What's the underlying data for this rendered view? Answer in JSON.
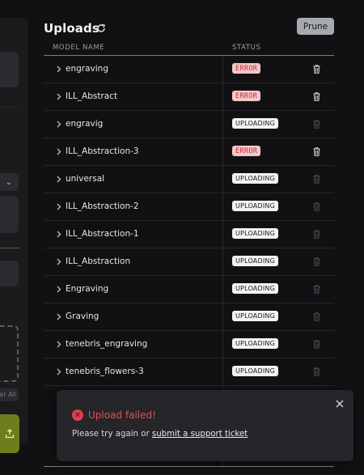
{
  "header": {
    "title": "Uploads",
    "prune_label": "Prune"
  },
  "table": {
    "columns": {
      "name": "MODEL NAME",
      "status": "STATUS"
    },
    "rows": [
      {
        "name": "engraving",
        "status": "ERROR",
        "state": "error"
      },
      {
        "name": "ILL_Abstract",
        "status": "ERROR",
        "state": "error"
      },
      {
        "name": "engravig",
        "status": "UPLOADING",
        "state": "uploading"
      },
      {
        "name": "ILL_Abstraction-3",
        "status": "ERROR",
        "state": "error"
      },
      {
        "name": "universal",
        "status": "UPLOADING",
        "state": "uploading"
      },
      {
        "name": "ILL_Abstraction-2",
        "status": "UPLOADING",
        "state": "uploading"
      },
      {
        "name": "ILL_Abstraction-1",
        "status": "UPLOADING",
        "state": "uploading"
      },
      {
        "name": "ILL_Abstraction",
        "status": "UPLOADING",
        "state": "uploading"
      },
      {
        "name": "Engraving",
        "status": "UPLOADING",
        "state": "uploading"
      },
      {
        "name": "Graving",
        "status": "UPLOADING",
        "state": "uploading"
      },
      {
        "name": "tenebris_engraving",
        "status": "UPLOADING",
        "state": "uploading"
      },
      {
        "name": "tenebris_flowers-3",
        "status": "UPLOADING",
        "state": "uploading"
      }
    ]
  },
  "left_panel": {
    "clear_all_label": "ar All"
  },
  "toast": {
    "title": "Upload failed!",
    "message_prefix": "Please try again or ",
    "link_text": "submit a support ticket"
  },
  "colors": {
    "error": "#e1404a",
    "accent": "#6f7d1c"
  },
  "icons": [
    "refresh-icon",
    "chevron-right-icon",
    "trash-icon",
    "error-icon",
    "close-icon",
    "upload-icon",
    "chevron-down-icon"
  ]
}
